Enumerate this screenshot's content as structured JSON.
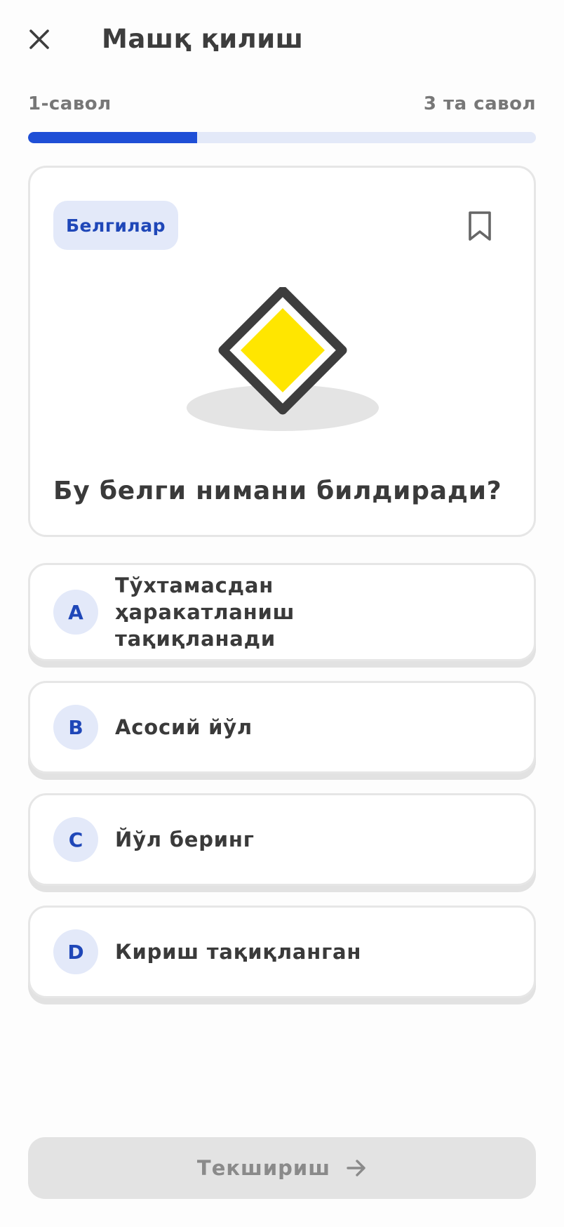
{
  "header": {
    "title": "Машқ қилиш",
    "close_icon": "close-icon"
  },
  "progress": {
    "current_label": "1-савол",
    "total_label": "3 та савол",
    "fraction": 0.333,
    "fill_color": "#1f4fd6",
    "track_color": "#e3e9f8"
  },
  "question": {
    "category": "Белгилар",
    "bookmark_icon": "bookmark-icon",
    "image_icon": "priority-road-sign",
    "text": "Бу белги нимани билдиради?"
  },
  "options": [
    {
      "letter": "A",
      "text": "Тўхтамасдан ҳаракатланиш тақиқланади"
    },
    {
      "letter": "B",
      "text": "Асосий йўл"
    },
    {
      "letter": "C",
      "text": "Йўл беринг"
    },
    {
      "letter": "D",
      "text": "Кириш тақиқланган"
    }
  ],
  "footer": {
    "check_label": "Текшириш",
    "arrow_icon": "arrow-right-icon"
  },
  "colors": {
    "accent": "#1f47b8",
    "sign_yellow": "#ffe600",
    "sign_border": "#3d3d3d"
  }
}
